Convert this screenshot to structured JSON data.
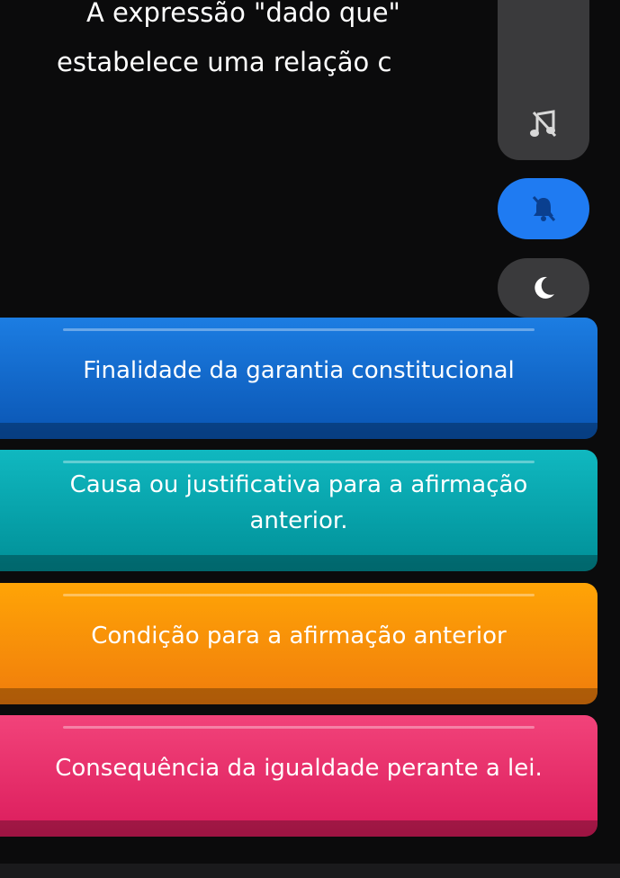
{
  "question": {
    "line1": "A expressão \"dado que\"",
    "line2": "estabelece uma relação c"
  },
  "controls": {
    "music_icon": "music-off-icon",
    "bell_icon": "bell-off-icon",
    "moon_icon": "moon-icon",
    "colors": {
      "panel": "#3a3a3c",
      "bell_active": "#1f7bf2"
    }
  },
  "answers": [
    {
      "text": "Finalidade da garantia constitucional",
      "color": "#1c7de2"
    },
    {
      "text": "Causa ou justificativa para a afirmação anterior.",
      "color": "#10b8c0"
    },
    {
      "text": "Condição para a afirmação anterior",
      "color": "#ffa406"
    },
    {
      "text": "Consequência da igualdade perante a lei.",
      "color": "#f2437a"
    }
  ]
}
